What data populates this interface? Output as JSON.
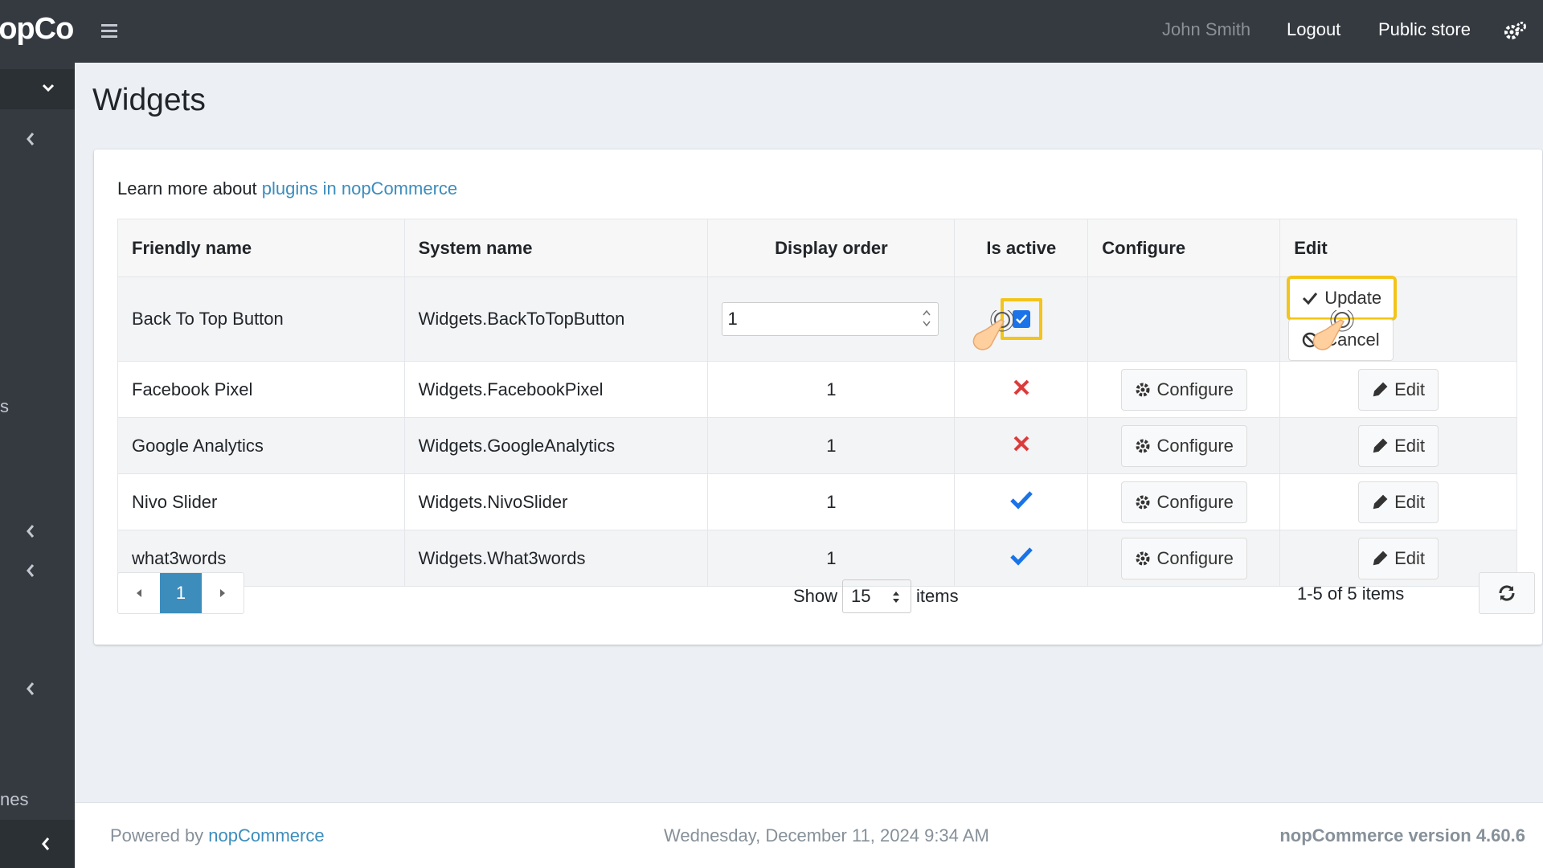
{
  "brand": {
    "text": "nopCommerce"
  },
  "sidebar": {
    "text_items": [
      "s",
      "nes"
    ]
  },
  "navbar": {
    "user": "John Smith",
    "logout": "Logout",
    "public_store": "Public store"
  },
  "page": {
    "title": "Widgets"
  },
  "learn": {
    "prefix": "Learn more about ",
    "link": "plugins in nopCommerce"
  },
  "table": {
    "headers": {
      "friendly": "Friendly name",
      "system": "System name",
      "order": "Display order",
      "active": "Is active",
      "configure": "Configure",
      "edit": "Edit"
    },
    "edit_row": {
      "friendly": "Back To Top Button",
      "system": "Widgets.BackToTopButton",
      "order_value": "1",
      "active": true,
      "update_label": "Update",
      "cancel_label": "Cancel"
    },
    "rows": [
      {
        "friendly": "Facebook Pixel",
        "system": "Widgets.FacebookPixel",
        "order": "1",
        "active": false,
        "configure": "Configure",
        "edit": "Edit"
      },
      {
        "friendly": "Google Analytics",
        "system": "Widgets.GoogleAnalytics",
        "order": "1",
        "active": false,
        "configure": "Configure",
        "edit": "Edit"
      },
      {
        "friendly": "Nivo Slider",
        "system": "Widgets.NivoSlider",
        "order": "1",
        "active": true,
        "configure": "Configure",
        "edit": "Edit"
      },
      {
        "friendly": "what3words",
        "system": "Widgets.What3words",
        "order": "1",
        "active": true,
        "configure": "Configure",
        "edit": "Edit"
      }
    ]
  },
  "pager": {
    "current": "1",
    "show_label": "Show",
    "page_size": "15",
    "items_label": "items",
    "count": "1-5 of 5 items"
  },
  "footer": {
    "powered_prefix": "Powered by ",
    "powered_link": "nopCommerce",
    "date": "Wednesday, December 11, 2024 9:34 AM",
    "version": "nopCommerce version 4.60.6"
  },
  "colors": {
    "accent": "#3c8dbc",
    "highlight": "#f3c41a",
    "check": "#1a73e8",
    "cross": "#dd3b3b",
    "sidebar": "#343a40"
  }
}
